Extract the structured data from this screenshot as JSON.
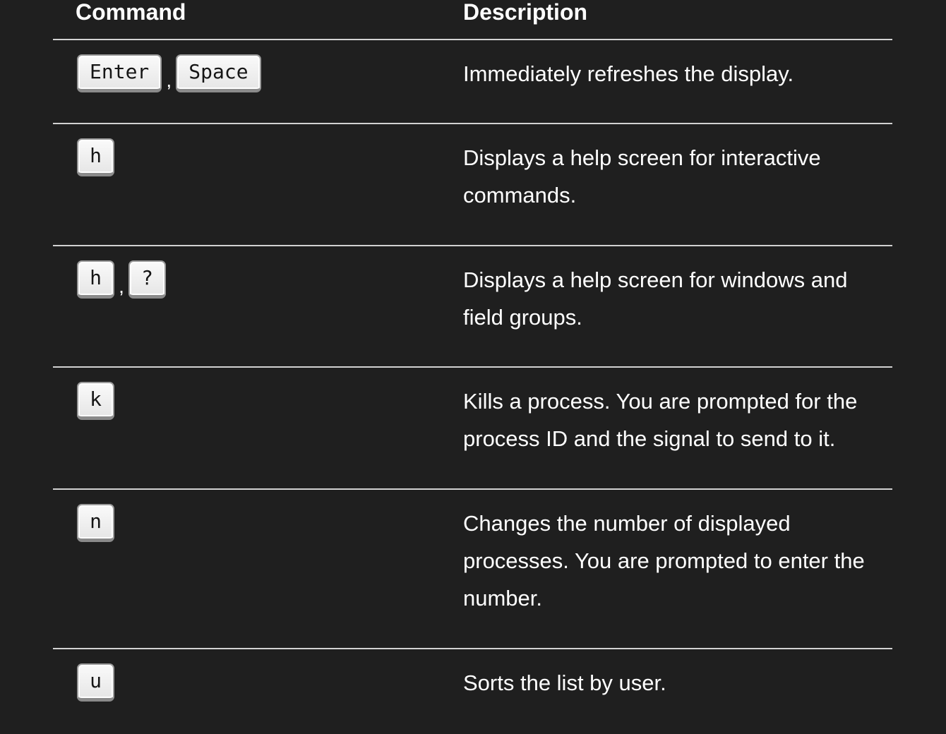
{
  "table": {
    "headers": {
      "command": "Command",
      "description": "Description"
    },
    "rows": [
      {
        "keys": [
          "Enter",
          "Space"
        ],
        "separator": ",",
        "description": "Immediately refreshes the display."
      },
      {
        "keys": [
          "h"
        ],
        "description": "Displays a help screen for interactive commands."
      },
      {
        "keys": [
          "h",
          "?"
        ],
        "separator": ",",
        "description": "Displays a help screen for windows and field groups."
      },
      {
        "keys": [
          "k"
        ],
        "description": "Kills a process. You are prompted for the process ID and the signal to send to it."
      },
      {
        "keys": [
          "n"
        ],
        "description": "Changes the number of displayed processes. You are prompted to enter the number."
      },
      {
        "keys": [
          "u"
        ],
        "description": "Sorts the list by user."
      }
    ]
  },
  "colors": {
    "background": "#1f1f1f",
    "text": "#ffffff",
    "divider": "#d2d2d2",
    "key_face": "#f0f0f0",
    "key_border": "#9a9a9a"
  }
}
